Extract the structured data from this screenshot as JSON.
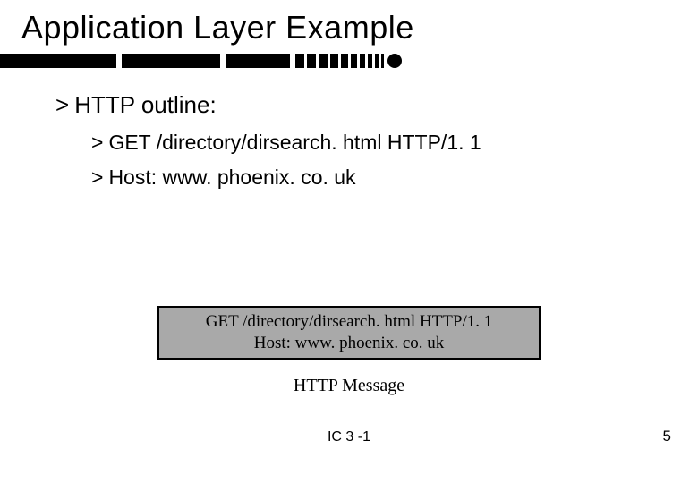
{
  "title": "Application Layer Example",
  "outline": {
    "heading": "HTTP outline:",
    "items": [
      "GET /directory/dirsearch. html HTTP/1. 1",
      "Host: www. phoenix. co. uk"
    ]
  },
  "message_box": {
    "line1": "GET /directory/dirsearch. html HTTP/1. 1",
    "line2": "Host: www. phoenix. co. uk"
  },
  "message_label": "HTTP Message",
  "footer": {
    "center": "IC 3 -1",
    "right": "5"
  },
  "glyphs": {
    "chevron": ">"
  }
}
